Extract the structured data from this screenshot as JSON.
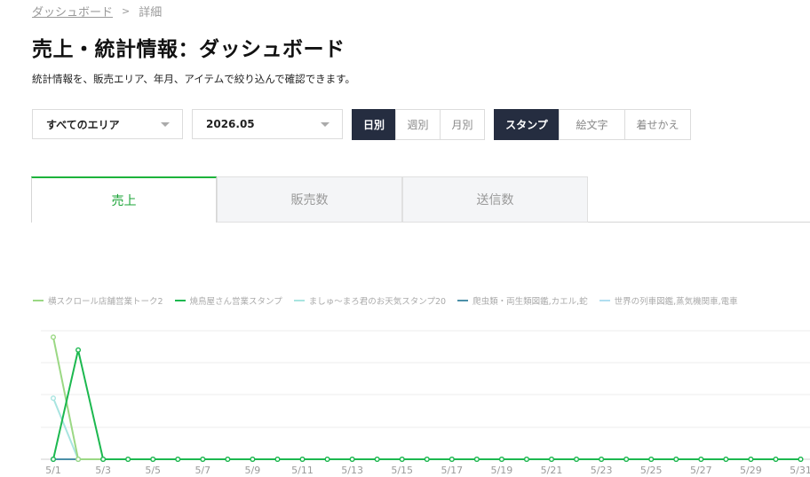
{
  "breadcrumb": {
    "parent": "ダッシュボード",
    "separator": ">",
    "current": "詳細"
  },
  "page": {
    "title": "売上・統計情報：ダッシュボード",
    "description": "統計情報を、販売エリア、年月、アイテムで絞り込んで確認できます。"
  },
  "filters": {
    "area": {
      "value": "すべてのエリア"
    },
    "month": {
      "value": "2026.05"
    },
    "period": {
      "options": [
        "日別",
        "週別",
        "月別"
      ],
      "selected": "日別"
    },
    "item_type": {
      "options": [
        "スタンプ",
        "絵文字",
        "着せかえ"
      ],
      "selected": "スタンプ"
    }
  },
  "tabs": {
    "items": [
      "売上",
      "販売数",
      "送信数"
    ],
    "active": "売上"
  },
  "chart_data": {
    "type": "line",
    "x": [
      "5/1",
      "5/2",
      "5/3",
      "5/4",
      "5/5",
      "5/6",
      "5/7",
      "5/8",
      "5/9",
      "5/10",
      "5/11",
      "5/12",
      "5/13",
      "5/14",
      "5/15",
      "5/16",
      "5/17",
      "5/18",
      "5/19",
      "5/20",
      "5/21",
      "5/22",
      "5/23",
      "5/24",
      "5/25",
      "5/26",
      "5/27",
      "5/28",
      "5/29",
      "5/30",
      "5/31"
    ],
    "tick_labels": [
      "5/1",
      "5/3",
      "5/5",
      "5/7",
      "5/9",
      "5/11",
      "5/13",
      "5/15",
      "5/17",
      "5/19",
      "5/21",
      "5/23",
      "5/25",
      "5/27",
      "5/29",
      "5/31"
    ],
    "grid": true,
    "legend_position": "top-left",
    "series": [
      {
        "name": "横スクロール店舗営業トーク2",
        "color": "#9bd884",
        "values": [
          38,
          0,
          0,
          0,
          0,
          0,
          0,
          0,
          0,
          0,
          0,
          0,
          0,
          0,
          0,
          0,
          0,
          0,
          0,
          0,
          0,
          0,
          0,
          0,
          0,
          0,
          0,
          0,
          0,
          0,
          0
        ]
      },
      {
        "name": "焼鳥屋さん営業スタンプ",
        "color": "#1cb84f",
        "values": [
          0,
          34,
          0,
          0,
          0,
          0,
          0,
          0,
          0,
          0,
          0,
          0,
          0,
          0,
          0,
          0,
          0,
          0,
          0,
          0,
          0,
          0,
          0,
          0,
          0,
          0,
          0,
          0,
          0,
          0,
          0
        ]
      },
      {
        "name": "ましゅ～まろ君のお天気スタンプ20",
        "color": "#a8e4e0",
        "values": [
          19,
          0,
          0,
          0,
          0,
          0,
          0,
          0,
          0,
          0,
          0,
          0,
          0,
          0,
          0,
          0,
          0,
          0,
          0,
          0,
          0,
          0,
          0,
          0,
          0,
          0,
          0,
          0,
          0,
          0,
          0
        ]
      },
      {
        "name": "爬虫類・両生類図鑑,カエル,蛇",
        "color": "#4b8fa8",
        "values": [
          0,
          0,
          0,
          0,
          0,
          0,
          0,
          0,
          0,
          0,
          0,
          0,
          0,
          0,
          0,
          0,
          0,
          0,
          0,
          0,
          0,
          0,
          0,
          0,
          0,
          0,
          0,
          0,
          0,
          0,
          0
        ]
      },
      {
        "name": "世界の列車図鑑,蒸気機関車,電車",
        "color": "#b0def0",
        "values": [
          0,
          0,
          0,
          0,
          0,
          0,
          0,
          0,
          0,
          0,
          0,
          0,
          0,
          0,
          0,
          0,
          0,
          0,
          0,
          0,
          0,
          0,
          0,
          0,
          0,
          0,
          0,
          0,
          0,
          0,
          0
        ]
      }
    ],
    "ylim": [
      0,
      40
    ]
  }
}
